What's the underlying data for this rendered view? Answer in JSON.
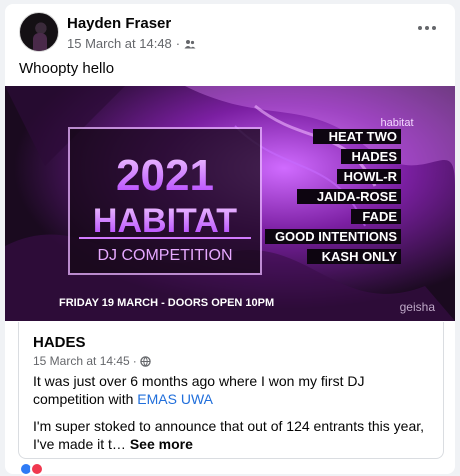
{
  "post": {
    "author": "Hayden Fraser",
    "timestamp": "15 March at 14:48",
    "privacy_separator": "·",
    "text": "Whoopty hello"
  },
  "banner": {
    "brand_small": "habitat",
    "year": "2021",
    "name": "HABITAT",
    "subtitle": "DJ COMPETITION",
    "lineup": [
      "HEAT TWO",
      "HADES",
      "HOWL-R",
      "JAIDA-ROSE",
      "FADE",
      "GOOD INTENTIONS",
      "KASH ONLY"
    ],
    "date_line": "FRIDAY 19 MARCH - DOORS OPEN 10PM",
    "venue": "geisha"
  },
  "shared_post": {
    "title": "HADES",
    "timestamp": "15 March at 14:45",
    "separator": "·",
    "body_line1": "It was just over 6 months ago where I won my first DJ competition with ",
    "mention": "EMAS UWA",
    "body_line2": "I'm super stoked to announce that out of 124 entrants this year, I've made it t… ",
    "see_more": "See more"
  },
  "colors": {
    "accent_purple": "#b13cff",
    "link_blue": "#216fdb"
  },
  "icons": {
    "privacy": "friends-icon",
    "shared_privacy": "globe-icon",
    "menu": "more-options-icon"
  }
}
